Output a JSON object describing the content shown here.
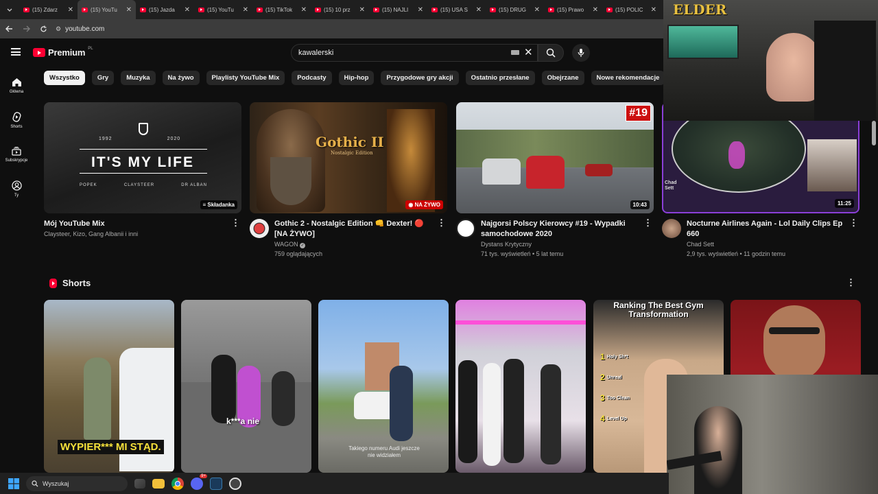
{
  "browser": {
    "tabs": [
      {
        "title": "(15) Zdarz",
        "active": false
      },
      {
        "title": "(15) YouTu",
        "active": true
      },
      {
        "title": "(15) Jazda",
        "active": false
      },
      {
        "title": "(15) YouTu",
        "active": false
      },
      {
        "title": "(15) TikTok",
        "active": false
      },
      {
        "title": "(15) 10 prz",
        "active": false
      },
      {
        "title": "(15) NAJLI",
        "active": false
      },
      {
        "title": "(15) USA S",
        "active": false
      },
      {
        "title": "(15) DRUG",
        "active": false
      },
      {
        "title": "(15) Prawo",
        "active": false
      },
      {
        "title": "(15) POLIC",
        "active": false
      }
    ],
    "url": "youtube.com"
  },
  "header": {
    "logo_text": "Premium",
    "logo_region": "PL",
    "search_value": "kawalerski"
  },
  "chips": [
    "Wszystko",
    "Gry",
    "Muzyka",
    "Na żywo",
    "Playlisty YouTube Mix",
    "Podcasty",
    "Hip-hop",
    "Przygodowe gry akcji",
    "Ostatnio przesłane",
    "Obejrzane",
    "Nowe rekomendacje"
  ],
  "sidebar": [
    {
      "label": "Główna",
      "icon": "home-icon"
    },
    {
      "label": "Shorts",
      "icon": "shorts-icon"
    },
    {
      "label": "Subskrypcje",
      "icon": "subscriptions-icon"
    },
    {
      "label": "Ty",
      "icon": "account-icon"
    }
  ],
  "videos": [
    {
      "title": "Mój YouTube Mix",
      "channel": "Claysteer, Kizo, Gang Albanii i inni",
      "stats": "",
      "badge": "Składanka",
      "thumb_text": "IT'S MY LIFE",
      "thumb_years": [
        "1992",
        "2020"
      ],
      "thumb_artists": [
        "POPEK",
        "CLAYSTEER",
        "DR ALBAN"
      ],
      "accent": "#888888"
    },
    {
      "title": "Gothic 2 - Nostalgic Edition 👊 Dexter! 🔴 [NA ŻYWO]",
      "channel": "WAGON",
      "stats": "759 oglądających",
      "badge": "NA ŻYWO",
      "thumb_text": "Gothic II",
      "thumb_sub": "Nostalgic Edition",
      "accent": "#cc0000"
    },
    {
      "title": "Najgorsi Polscy Kierowcy #19 - Wypadki samochodowe 2020",
      "channel": "Dystans Krytyczny",
      "stats": "71 tys. wyświetleń • 5 lat temu",
      "badge": "10:43",
      "thumb_text": "#19",
      "accent": "#ffffff"
    },
    {
      "title": "Nocturne Airlines Again - Lol Daily Clips Ep 660",
      "channel": "Chad Sett",
      "stats": "2,9 tys. wyświetleń • 11 godzin temu",
      "badge": "11:25",
      "thumb_text": "Chad Sett",
      "accent": "#8b3fd9"
    }
  ],
  "shorts_section": {
    "title": "Shorts",
    "items": [
      {
        "caption": "WYPIER*** MI STĄD."
      },
      {
        "caption": "k***a nie"
      },
      {
        "caption": "Takiego numeru Audi jeszcze nie widziałem"
      },
      {
        "caption": ""
      },
      {
        "caption": "Ranking The Best Gym Transformation",
        "ranks": [
          "Holy Sh*t",
          "Unreal",
          "Too Clean",
          "Level Up"
        ]
      },
      {
        "caption": ""
      }
    ]
  },
  "overlay": {
    "streamer_logo": "ELDER"
  },
  "taskbar": {
    "search_placeholder": "Wyszukaj",
    "discord_badge": "9+"
  }
}
